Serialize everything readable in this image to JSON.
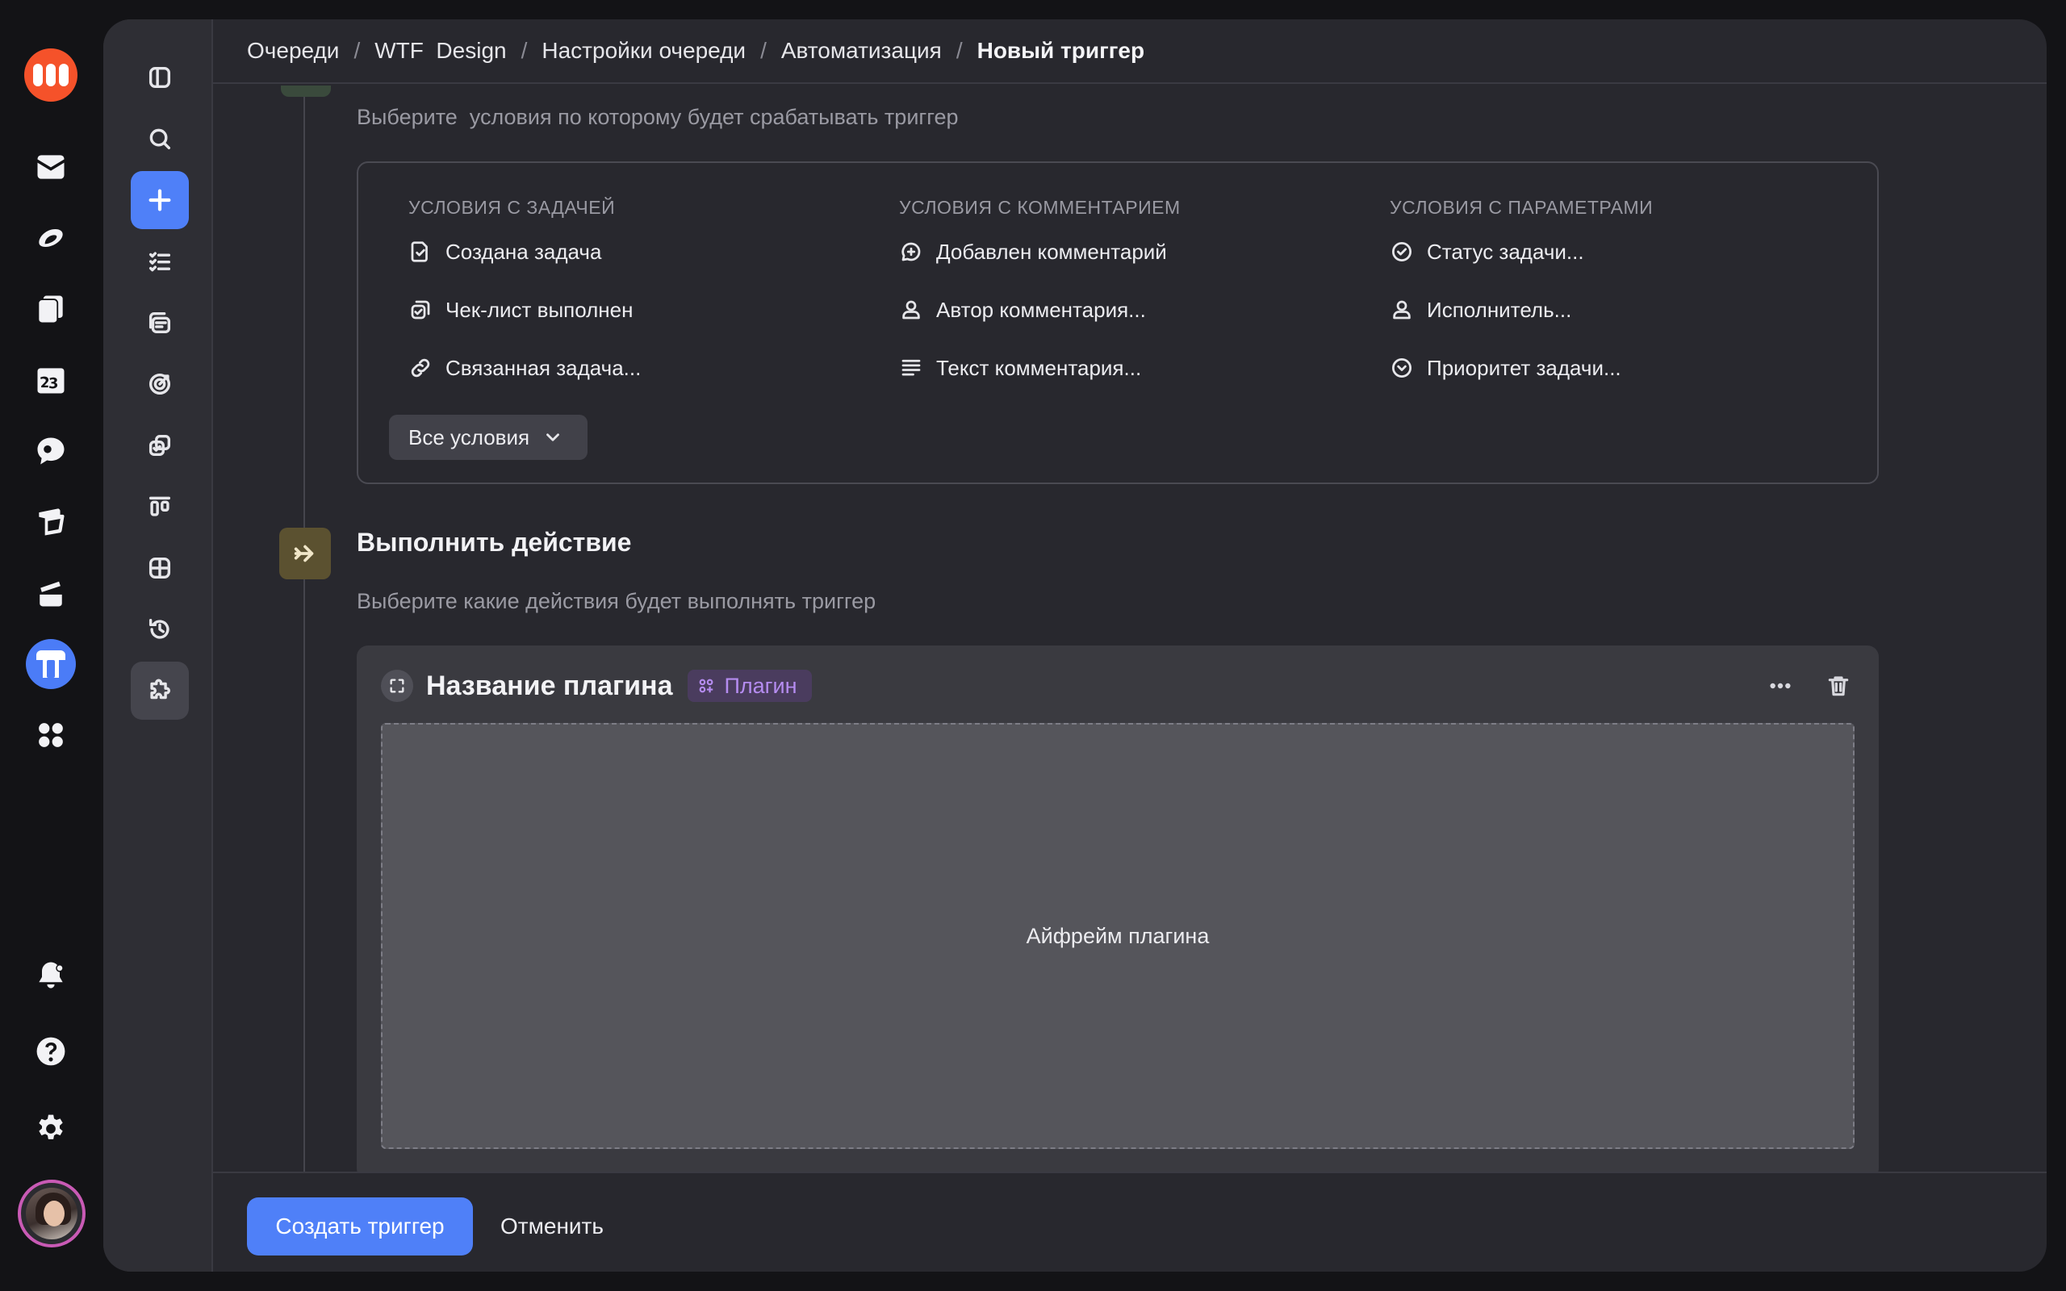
{
  "breadcrumbs": [
    {
      "label": "Очереди"
    },
    {
      "label": "WTF  Design"
    },
    {
      "label": "Настройки очереди"
    },
    {
      "label": "Автоматизация"
    },
    {
      "label": "Новый триггер"
    }
  ],
  "breadcrumb_separator": "/",
  "conditions": {
    "subtitle": "Выберите  условия по которому будет срабатывать триггер",
    "columns": [
      {
        "heading": "УСЛОВИЯ С ЗАДАЧЕЙ",
        "items": [
          {
            "label": "Создана задача",
            "icon": "file-check-icon"
          },
          {
            "label": "Чек-лист выполнен",
            "icon": "checklist-copy-icon"
          },
          {
            "label": "Связанная задача...",
            "icon": "link-icon"
          }
        ]
      },
      {
        "heading": "УСЛОВИЯ С КОММЕНТАРИЕМ",
        "items": [
          {
            "label": "Добавлен комментарий",
            "icon": "comment-plus-icon"
          },
          {
            "label": "Автор комментария...",
            "icon": "person-icon"
          },
          {
            "label": "Текст комментария...",
            "icon": "text-lines-icon"
          }
        ]
      },
      {
        "heading": "УСЛОВИЯ С ПАРАМЕТРАМИ",
        "items": [
          {
            "label": "Статус задачи...",
            "icon": "circle-check-icon"
          },
          {
            "label": "Исполнитель...",
            "icon": "person-icon"
          },
          {
            "label": "Приоритет задачи...",
            "icon": "circle-chevron-down-icon"
          }
        ]
      }
    ],
    "all_button": "Все условия"
  },
  "action": {
    "title": "Выполнить действие",
    "subtitle": "Выберите какие действия будет выполнять триггер",
    "plugin": {
      "name": "Название плагина",
      "badge": "Плагин",
      "iframe_label": "Айфрейм плагина"
    }
  },
  "footer": {
    "create_label": "Создать триггер",
    "cancel_label": "Отменить"
  },
  "colors": {
    "accent": "#4f80f8",
    "plugin_badge_text": "#b58cf0",
    "brand_logo": "#f5522a"
  }
}
